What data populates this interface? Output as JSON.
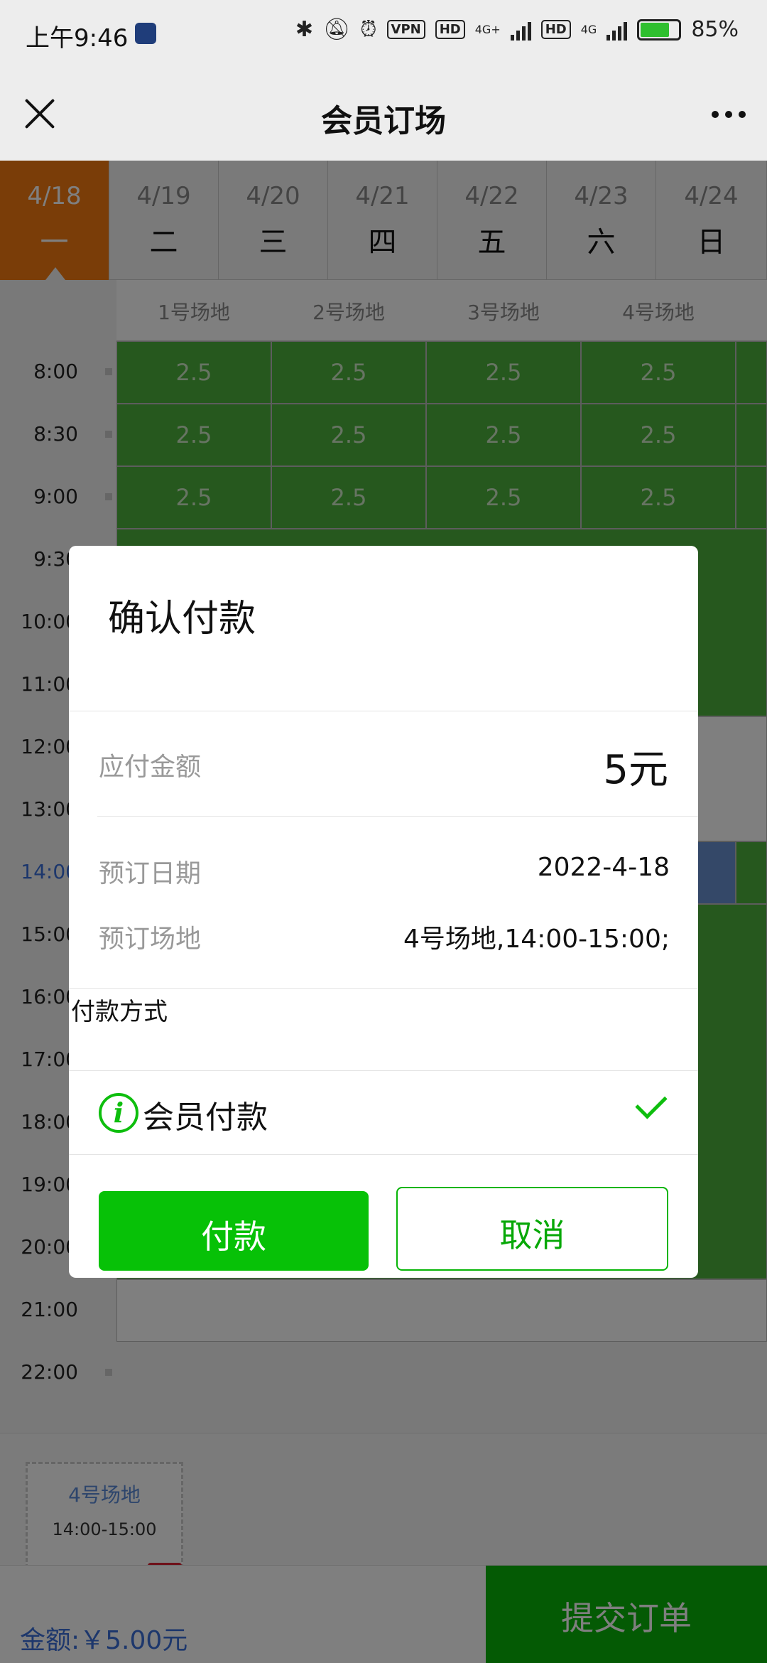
{
  "status_bar": {
    "time": "上午9:46",
    "vpn": "VPN",
    "hd": "HD",
    "net1": "4G+",
    "net2": "4G",
    "battery": "85%"
  },
  "nav": {
    "title": "会员订场"
  },
  "dates": [
    {
      "date": "4/18",
      "weekday": "一",
      "active": true
    },
    {
      "date": "4/19",
      "weekday": "二"
    },
    {
      "date": "4/20",
      "weekday": "三"
    },
    {
      "date": "4/21",
      "weekday": "四"
    },
    {
      "date": "4/22",
      "weekday": "五"
    },
    {
      "date": "4/23",
      "weekday": "六"
    },
    {
      "date": "4/24",
      "weekday": "日"
    }
  ],
  "courts": [
    "1号场地",
    "2号场地",
    "3号场地",
    "4号场地"
  ],
  "times": [
    "8:00",
    "8:30",
    "9:00",
    "9:30",
    "10:00",
    "11:00",
    "12:00",
    "13:00",
    "14:00",
    "15:00",
    "16:00",
    "17:00",
    "18:00",
    "19:00",
    "20:00",
    "21:00",
    "22:00"
  ],
  "price_label": "2.5",
  "selected_slot": {
    "court": "4号场地",
    "time": "14:00-15:00"
  },
  "footer": {
    "total": "金额:￥5.00元",
    "submit": "提交订单"
  },
  "dialog": {
    "title": "确认付款",
    "amount_label": "应付金额",
    "amount_value": "5元",
    "date_label": "预订日期",
    "date_value": "2022-4-18",
    "court_label": "预订场地",
    "court_value": "4号场地,14:00-15:00;",
    "payment_method_label": "付款方式",
    "payment_option": "会员付款",
    "pay_button": "付款",
    "cancel_button": "取消"
  },
  "colors": {
    "accent_green": "#07c107",
    "orange": "#f47a10",
    "blue": "#3a6fd8"
  }
}
